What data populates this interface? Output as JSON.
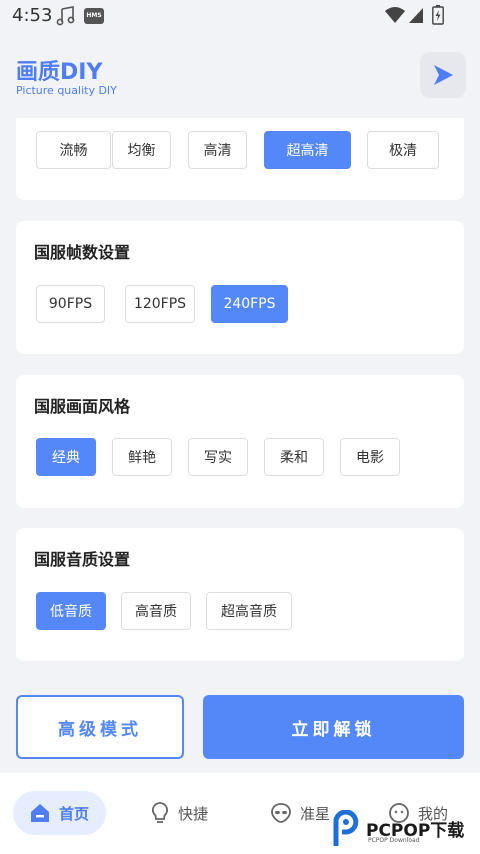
{
  "status_bar": {
    "time": "4:53",
    "badge": "HMS"
  },
  "header": {
    "title": "画质DIY",
    "subtitle": "Picture quality DIY"
  },
  "sections": {
    "quality": {
      "options": [
        "流畅",
        "均衡",
        "高清",
        "超高清",
        "极清"
      ],
      "selected": "超高清"
    },
    "fps": {
      "title": "国服帧数设置",
      "options": [
        "90FPS",
        "120FPS",
        "240FPS"
      ],
      "selected": "240FPS"
    },
    "style": {
      "title": "国服画面风格",
      "options": [
        "经典",
        "鲜艳",
        "写实",
        "柔和",
        "电影"
      ],
      "selected": "经典"
    },
    "audio": {
      "title": "国服音质设置",
      "options": [
        "低音质",
        "高音质",
        "超高音质"
      ],
      "selected": "低音质"
    }
  },
  "actions": {
    "advanced_label": "高级模式",
    "unlock_label": "立即解锁"
  },
  "tabbar": {
    "tabs": [
      "首页",
      "快捷",
      "准星",
      "我的"
    ],
    "active": "首页"
  },
  "watermark": {
    "text": "PCPOP下载",
    "small": "PCPOP Download"
  },
  "colors": {
    "accent": "#5487f8",
    "background": "#f2f3f6",
    "card": "#ffffff"
  }
}
